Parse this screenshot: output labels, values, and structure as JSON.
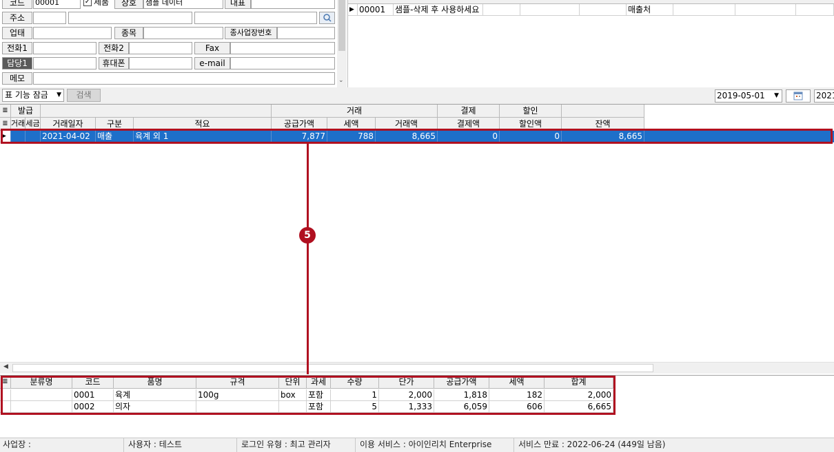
{
  "form": {
    "code_label": "코드",
    "code_value": "00001",
    "hide_label": "제품",
    "company_label": "상호",
    "company_value": "샘플 데이터",
    "rep_label": "대표",
    "address_label": "주소",
    "business_type_label": "업태",
    "item_label": "종목",
    "branch_no_label": "종사업장번호",
    "phone1_label": "전화1",
    "phone2_label": "전화2",
    "fax_label": "Fax",
    "manager_label": "담당1",
    "mobile_label": "휴대폰",
    "email_label": "e-mail",
    "memo_label": "메모"
  },
  "customer_grid": {
    "row": {
      "code": "00001",
      "name": "샘플-삭제 후 사용하세요",
      "type": "매출처"
    }
  },
  "toolbar": {
    "lock_label": "표 기능 잠금",
    "search_label": "검색",
    "date_from": "2019-05-01",
    "date_to": "2021-"
  },
  "grid": {
    "group_headers": [
      "발급",
      "거래",
      "결제",
      "할인"
    ],
    "headers": [
      "거래",
      "세금",
      "거래일자",
      "구분",
      "적요",
      "공급가액",
      "세액",
      "거래액",
      "결제액",
      "할인액",
      "잔액"
    ],
    "rows": [
      {
        "date": "2021-04-02",
        "kind": "매출",
        "summary": "육계 외 1",
        "supply": "7,877",
        "tax": "788",
        "amount": "8,665",
        "paid": "0",
        "discount": "0",
        "balance": "8,665"
      }
    ]
  },
  "callout": {
    "number": "5"
  },
  "detail": {
    "headers": [
      "분류명",
      "코드",
      "품명",
      "규격",
      "단위",
      "과세",
      "수량",
      "단가",
      "공급가액",
      "세액",
      "합계"
    ],
    "rows": [
      {
        "category": "",
        "code": "0001",
        "name": "육계",
        "spec": "100g",
        "unit": "box",
        "taxation": "포함",
        "qty": "1",
        "price": "2,000",
        "supply": "1,818",
        "tax": "182",
        "total": "2,000"
      },
      {
        "category": "",
        "code": "0002",
        "name": "의자",
        "spec": "",
        "unit": "",
        "taxation": "포함",
        "qty": "5",
        "price": "1,333",
        "supply": "6,059",
        "tax": "606",
        "total": "6,665"
      }
    ]
  },
  "status": {
    "business": "사업장 :",
    "user": "사용자 : 테스트",
    "login": "로그인 유형 : 최고 관리자",
    "service": "이용 서비스 : 아이인리치 Enterprise",
    "expiry": "서비스 만료 : 2022-06-24 (449일 남음)"
  }
}
